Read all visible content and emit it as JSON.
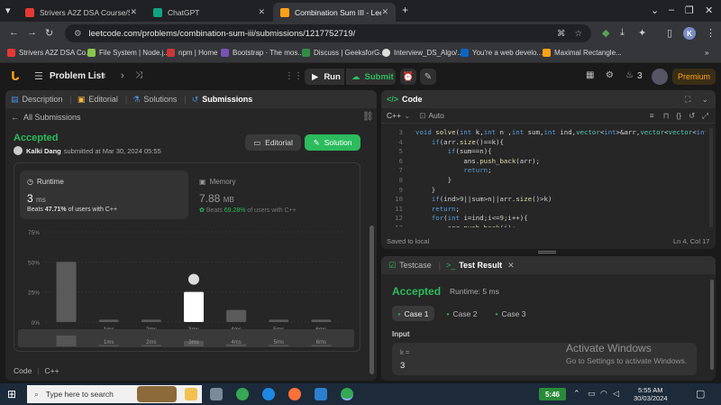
{
  "browser": {
    "tabs": [
      {
        "title": "Strivers A2Z DSA Course/Sheet",
        "color": "#e53935"
      },
      {
        "title": "ChatGPT",
        "color": "#10a37f"
      },
      {
        "title": "Combination Sum III - LeetCode",
        "color": "#ffa116"
      }
    ],
    "url": "leetcode.com/problems/combination-sum-iii/submissions/1217752719/",
    "bookmarks": [
      {
        "label": "Strivers A2Z DSA Co...",
        "color": "#e53935"
      },
      {
        "label": "File System | Node.j...",
        "color": "#8bc34a"
      },
      {
        "label": "npm | Home",
        "color": "#cb3837"
      },
      {
        "label": "Bootstrap · The mos...",
        "color": "#7952b3"
      },
      {
        "label": "Discuss | GeeksforG...",
        "color": "#2f8d46"
      },
      {
        "label": "Interview_DS_Algo/...",
        "color": "#dddddd"
      },
      {
        "label": "You're a web develo...",
        "color": "#0a66c2"
      },
      {
        "label": "Maximal Rectangle...",
        "color": "#ffa116"
      }
    ],
    "bookmarks_more": "»",
    "profile_initial": "K"
  },
  "lc": {
    "problem_list": "Problem List",
    "run": "Run",
    "submit": "Submit",
    "streak": "3",
    "premium": "Premium"
  },
  "left": {
    "tabs": [
      "Description",
      "Editorial",
      "Solutions",
      "Submissions"
    ],
    "back_label": "All Submissions",
    "status": "Accepted",
    "user": "Kalki Dang",
    "submitted": "submitted at Mar 30, 2024 05:55",
    "editorial_btn": "Editorial",
    "solution_btn": "Solution",
    "runtime_title": "Runtime",
    "runtime_value": "3",
    "runtime_unit": "ms",
    "runtime_beats_pre": "Beats",
    "runtime_beats_pct": "47.71%",
    "runtime_beats_post": "of users with C++",
    "memory_title": "Memory",
    "memory_value": "7.88",
    "memory_unit": "MB",
    "memory_beats_pre": "Beats",
    "memory_beats_pct": "69.28%",
    "memory_beats_post": "of users with C++",
    "footer_code": "Code",
    "footer_lang": "C++"
  },
  "chart_data": {
    "type": "bar",
    "categories": [
      "",
      "1ms",
      "2ms",
      "3ms",
      "4ms",
      "5ms",
      "6ms"
    ],
    "values": [
      50,
      2,
      2,
      25,
      10,
      2,
      2
    ],
    "highlight_index": 3,
    "yticks": [
      "75%",
      "50%",
      "25%",
      "0%"
    ],
    "ylim": [
      0,
      75
    ],
    "grid": true
  },
  "code": {
    "header": "Code",
    "lang": "C++",
    "mode": "Auto",
    "saved": "Saved to local",
    "cursor": "Ln 4, Col 17",
    "lines": [
      {
        "n": "3",
        "t": "void solve(int k,int n ,int sum,int ind,vector<int>&arr,vector<vector<int>>&ans){"
      },
      {
        "n": "4",
        "t": "    if(arr.size()==k){"
      },
      {
        "n": "5",
        "t": "        if(sum==n){"
      },
      {
        "n": "6",
        "t": "            ans.push_back(arr);"
      },
      {
        "n": "7",
        "t": "            return;"
      },
      {
        "n": "8",
        "t": "        }"
      },
      {
        "n": "9",
        "t": "    }"
      },
      {
        "n": "10",
        "t": "    if(ind>9||sum>n||arr.size()>k)"
      },
      {
        "n": "11",
        "t": "    return;"
      },
      {
        "n": "12",
        "t": "    for(int i=ind;i<=9;i++){"
      },
      {
        "n": "13",
        "t": "        arr.push_back(i);"
      }
    ]
  },
  "test": {
    "tab_testcase": "Testcase",
    "tab_result": "Test Result",
    "status": "Accepted",
    "runtime": "Runtime: 5 ms",
    "cases": [
      "Case 1",
      "Case 2",
      "Case 3"
    ],
    "input_label": "Input",
    "var_name": "k =",
    "var_value": "3"
  },
  "watermark": {
    "title": "Activate Windows",
    "sub": "Go to Settings to activate Windows."
  },
  "taskbar": {
    "search_placeholder": "Type here to search",
    "badge_time": "5:46",
    "clock_time": "5:55 AM",
    "clock_date": "30/03/2024"
  },
  "colors": {
    "accepted": "#2cbb5d",
    "accent": "#ffa116",
    "bar": "#5a5a5a",
    "bar_highlight": "#ffffff"
  }
}
